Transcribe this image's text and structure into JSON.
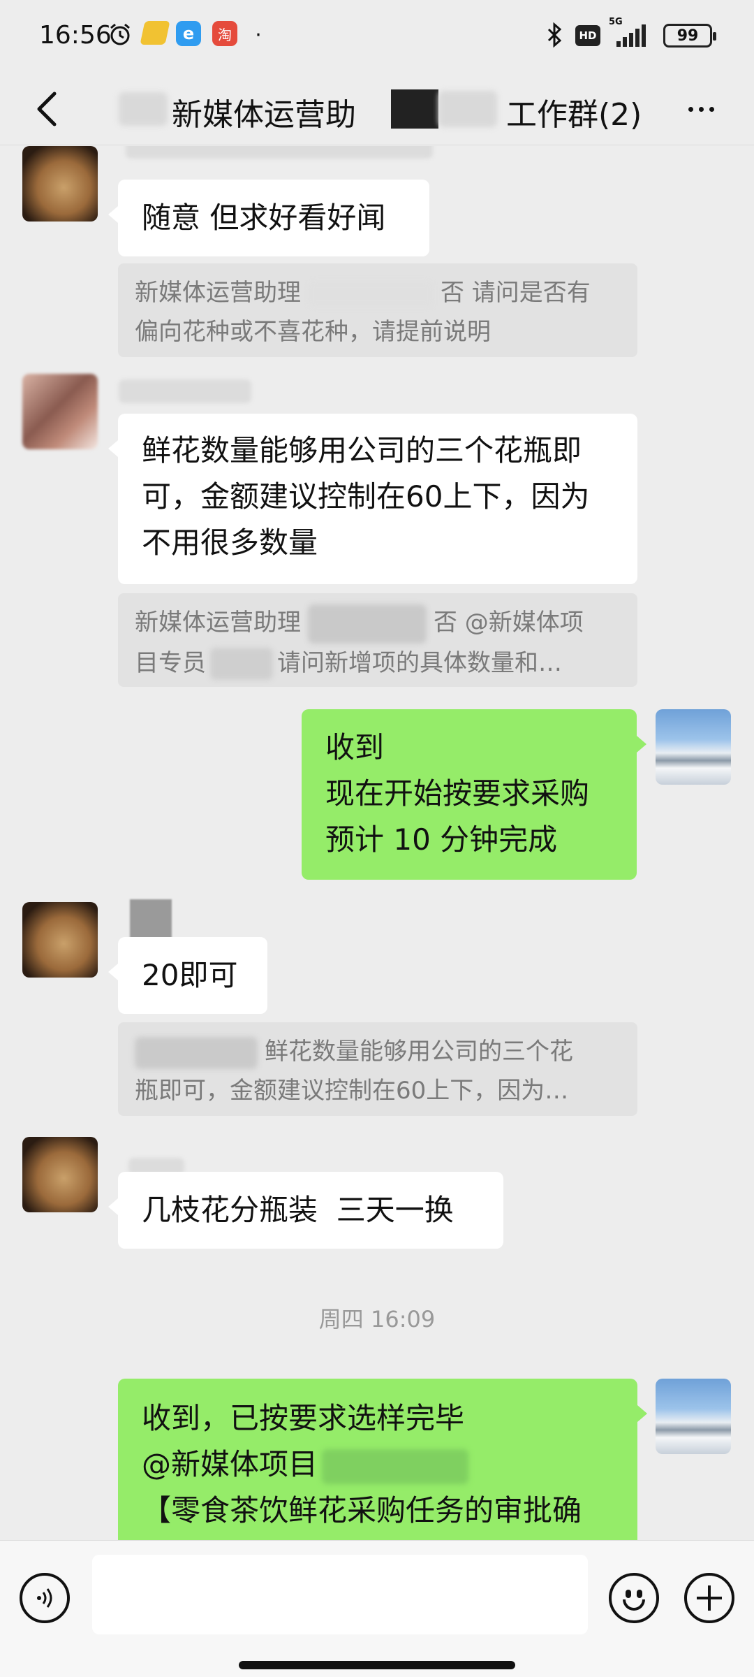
{
  "status_bar": {
    "time": "16:56",
    "signal_label": "5G",
    "hd_label": "HD",
    "battery": "99",
    "icons": [
      "alarm-icon",
      "app-notification-icon",
      "browser-app-icon",
      "taobao-app-icon",
      "bluetooth-icon",
      "signal-icon",
      "battery-icon"
    ]
  },
  "header": {
    "title_part1": "新媒体运营助",
    "title_part2": "工作群(2)"
  },
  "messages": [
    {
      "id": "m1",
      "direction": "incoming",
      "text_lines": [
        "随意 但求好看好闻"
      ],
      "quote_lines": [
        "新媒体运营助理",
        "否 请问是否有",
        "偏向花种或不喜花种，请提前说明"
      ]
    },
    {
      "id": "m2",
      "direction": "incoming",
      "text_lines": [
        "鲜花数量能够用公司的三个花瓶即",
        "可，金额建议控制在60上下，因为",
        "不用很多数量"
      ],
      "quote_lines": [
        "新媒体运营助理",
        "否 @新媒体项",
        "目专员",
        "请问新增项的具体数量和…"
      ]
    },
    {
      "id": "m3",
      "direction": "outgoing",
      "text_lines": [
        "收到",
        "现在开始按要求采购",
        "预计 10 分钟完成"
      ]
    },
    {
      "id": "m4",
      "direction": "incoming",
      "text_lines": [
        "20即可"
      ],
      "quote_lines": [
        "鲜花数量能够用公司的三个花",
        "瓶即可，金额建议控制在60上下，因为…"
      ]
    },
    {
      "id": "m5",
      "direction": "incoming",
      "text_lines": [
        "几枝花分瓶装  三天一换"
      ]
    },
    {
      "id": "m6",
      "direction": "outgoing",
      "text_lines": [
        "收到，已按要求选样完毕",
        "@新媒体项目",
        "【零食茶饮鲜花采购任务的审批确"
      ]
    }
  ],
  "timestamp": "周四 16:09",
  "input_bar": {
    "placeholder": ""
  }
}
